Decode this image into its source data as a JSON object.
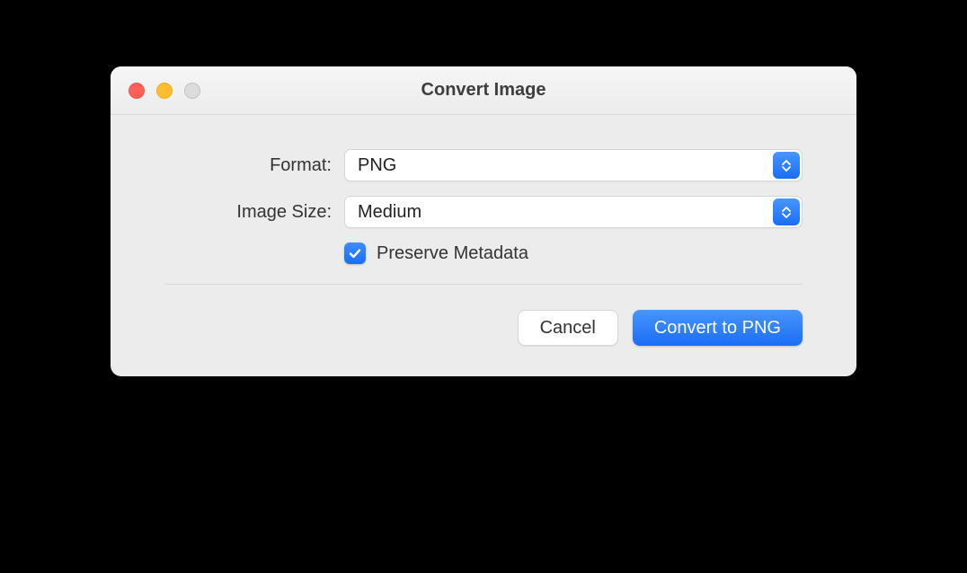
{
  "window": {
    "title": "Convert Image"
  },
  "form": {
    "format_label": "Format:",
    "format_value": "PNG",
    "image_size_label": "Image Size:",
    "image_size_value": "Medium",
    "preserve_metadata_label": "Preserve Metadata",
    "preserve_metadata_checked": true
  },
  "buttons": {
    "cancel": "Cancel",
    "convert": "Convert to PNG"
  }
}
